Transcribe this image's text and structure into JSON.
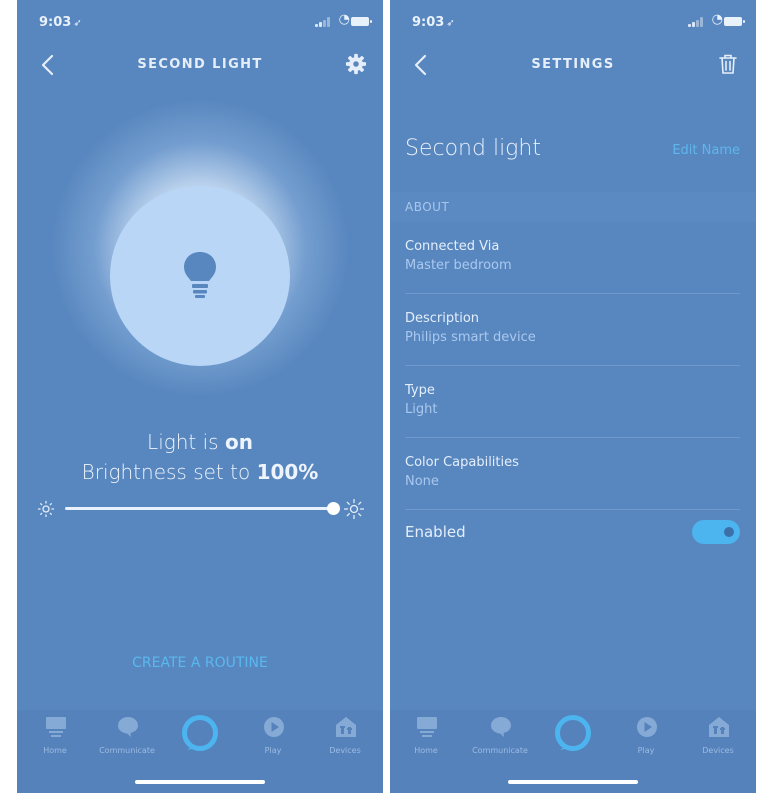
{
  "left": {
    "status": {
      "time": "9:03",
      "time_arrow": "➶"
    },
    "navbar": {
      "title": "SECOND LIGHT"
    },
    "light_status": {
      "prefix": "Light is ",
      "value": "on"
    },
    "brightness": {
      "prefix": "Brightness set to ",
      "value": "100%",
      "level": 1.0
    },
    "routine_link": "CREATE A ROUTINE"
  },
  "right": {
    "status": {
      "time": "9:03",
      "time_arrow": "➶"
    },
    "navbar": {
      "title": "SETTINGS"
    },
    "device_name": "Second light",
    "edit_name": "Edit Name",
    "section_header": "ABOUT",
    "rows": [
      {
        "label": "Connected Via",
        "value": "Master bedroom"
      },
      {
        "label": "Description",
        "value": "Philips smart device"
      },
      {
        "label": "Type",
        "value": "Light"
      },
      {
        "label": "Color Capabilities",
        "value": "None"
      }
    ],
    "enabled": {
      "label": "Enabled",
      "on": true
    }
  },
  "tabbar": {
    "home": "Home",
    "communicate": "Communicate",
    "play": "Play",
    "devices": "Devices"
  },
  "colors": {
    "background": "#5887bf",
    "accent": "#4cb4ee",
    "link": "#59b8ee",
    "bulb_circle": "#b9d6f6"
  },
  "icons": {
    "back": "chevron-left-icon",
    "settings": "gear-icon",
    "delete": "trash-icon",
    "bulb": "lightbulb-icon",
    "alexa": "alexa-ring-icon"
  }
}
